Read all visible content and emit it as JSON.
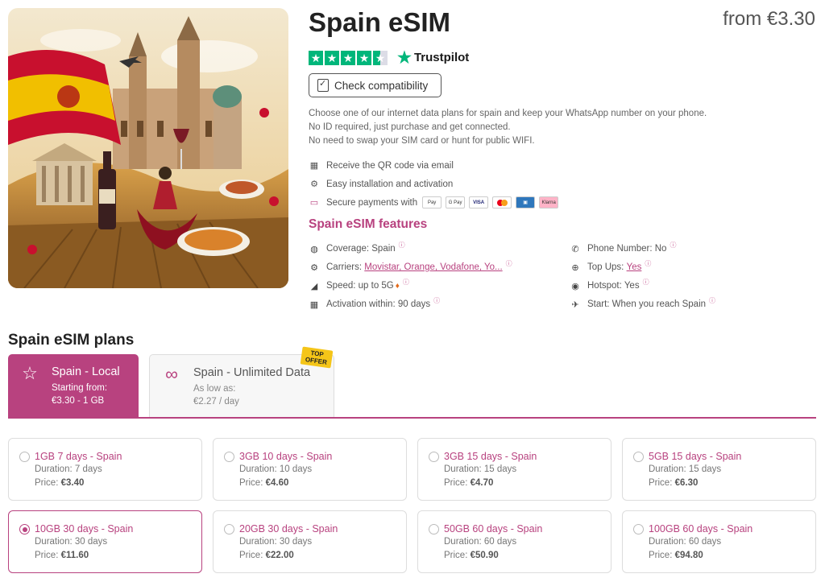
{
  "product": {
    "title": "Spain eSIM",
    "price_from": "from €3.30",
    "trustpilot": {
      "brand": "Trustpilot",
      "rating_stars": 4.5
    },
    "compat_button": "Check compatibility",
    "description": [
      "Choose one of our internet data plans for spain and keep your WhatsApp number on your phone.",
      "No ID required, just purchase and get connected.",
      "No need to swap your SIM card or hunt for public WIFI."
    ],
    "bullets": {
      "qr": "Receive the QR code via email",
      "install": "Easy installation and activation",
      "payments": "Secure payments with"
    },
    "payment_methods": [
      "Pay",
      "G Pay",
      "VISA",
      "MC",
      "AMEX",
      "Klarna"
    ]
  },
  "features": {
    "title": "Spain eSIM features",
    "coverage": "Coverage: Spain",
    "carriers_label": "Carriers:",
    "carriers_value": "Movistar, Orange, Vodafone, Yo...",
    "speed": "Speed: up to 5G",
    "activation": "Activation within: 90 days",
    "phone_number": "Phone Number: No",
    "top_ups_label": "Top Ups:",
    "top_ups_value": "Yes",
    "hotspot": "Hotspot: Yes",
    "start": "Start: When you reach Spain",
    "info_mark": "ⓘ"
  },
  "plans": {
    "title": "Spain eSIM plans",
    "tabs": [
      {
        "name": "Spain - Local",
        "sub1": "Starting from:",
        "sub2": "€3.30 - 1 GB"
      },
      {
        "name": "Spain - Unlimited Data",
        "sub1": "As low as:",
        "sub2": "€2.27 / day",
        "badge": "TOP OFFER"
      }
    ],
    "duration_label": "Duration:",
    "price_label": "Price:",
    "cards": [
      {
        "name": "1GB 7 days - Spain",
        "duration": "7 days",
        "price": "€3.40"
      },
      {
        "name": "3GB 10 days - Spain",
        "duration": "10 days",
        "price": "€4.60"
      },
      {
        "name": "3GB 15 days - Spain",
        "duration": "15 days",
        "price": "€4.70"
      },
      {
        "name": "5GB 15 days - Spain",
        "duration": "15 days",
        "price": "€6.30"
      },
      {
        "name": "10GB 30 days - Spain",
        "duration": "30 days",
        "price": "€11.60",
        "selected": true
      },
      {
        "name": "20GB 30 days - Spain",
        "duration": "30 days",
        "price": "€22.00"
      },
      {
        "name": "50GB 60 days - Spain",
        "duration": "60 days",
        "price": "€50.90"
      },
      {
        "name": "100GB 60 days - Spain",
        "duration": "60 days",
        "price": "€94.80"
      }
    ]
  },
  "colors": {
    "accent": "#b8427f",
    "trustpilot_green": "#00b67a"
  }
}
